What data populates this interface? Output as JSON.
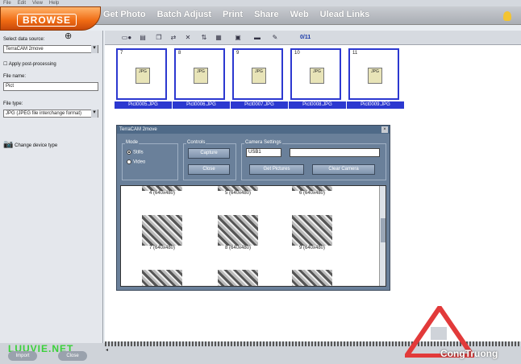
{
  "menubar": {
    "items": [
      "File",
      "Edit",
      "View",
      "Help"
    ]
  },
  "header": {
    "browse_label": "BROWSE",
    "tabs": [
      "Get Photo",
      "Batch Adjust",
      "Print",
      "Share",
      "Web",
      "Ulead Links"
    ]
  },
  "sidebar": {
    "data_source_label": "Select data source:",
    "data_source_value": "TerraCAM 2move",
    "post_processing_label": "Apply post-processing",
    "file_name_label": "File name:",
    "file_name_value": "Pict",
    "file_type_label": "File type:",
    "file_type_value": "JPG (JPEG file interchange format)",
    "change_device_label": "Change device type"
  },
  "toolbar": {
    "counter": "0/11"
  },
  "thumbnails": [
    {
      "num": "7",
      "name": "Pict0005.JPG"
    },
    {
      "num": "8",
      "name": "Pict0006.JPG"
    },
    {
      "num": "9",
      "name": "Pict0007.JPG"
    },
    {
      "num": "10",
      "name": "Pict0008.JPG"
    },
    {
      "num": "11",
      "name": "Pict0009.JPG"
    }
  ],
  "dialog": {
    "title": "TerraCAM 2move",
    "mode_label": "Mode",
    "mode_stills": "Stills",
    "mode_video": "Video",
    "controls_label": "Controls",
    "capture_btn": "Capture",
    "close_btn": "Close",
    "camera_settings_label": "Camera Settings",
    "port_value": "USB1",
    "get_pictures_btn": "Get Pictures",
    "clear_camera_btn": "Clear Camera",
    "gallery": [
      "4 (640x480)",
      "5 (640x480)",
      "6 (640x480)",
      "7 (640x480)",
      "8 (640x480)",
      "9 (640x480)"
    ]
  },
  "watermark": {
    "text": "LUUVIE.NET",
    "logo_text": "CongTruong",
    "btn1": "Import",
    "btn2": "Close"
  }
}
